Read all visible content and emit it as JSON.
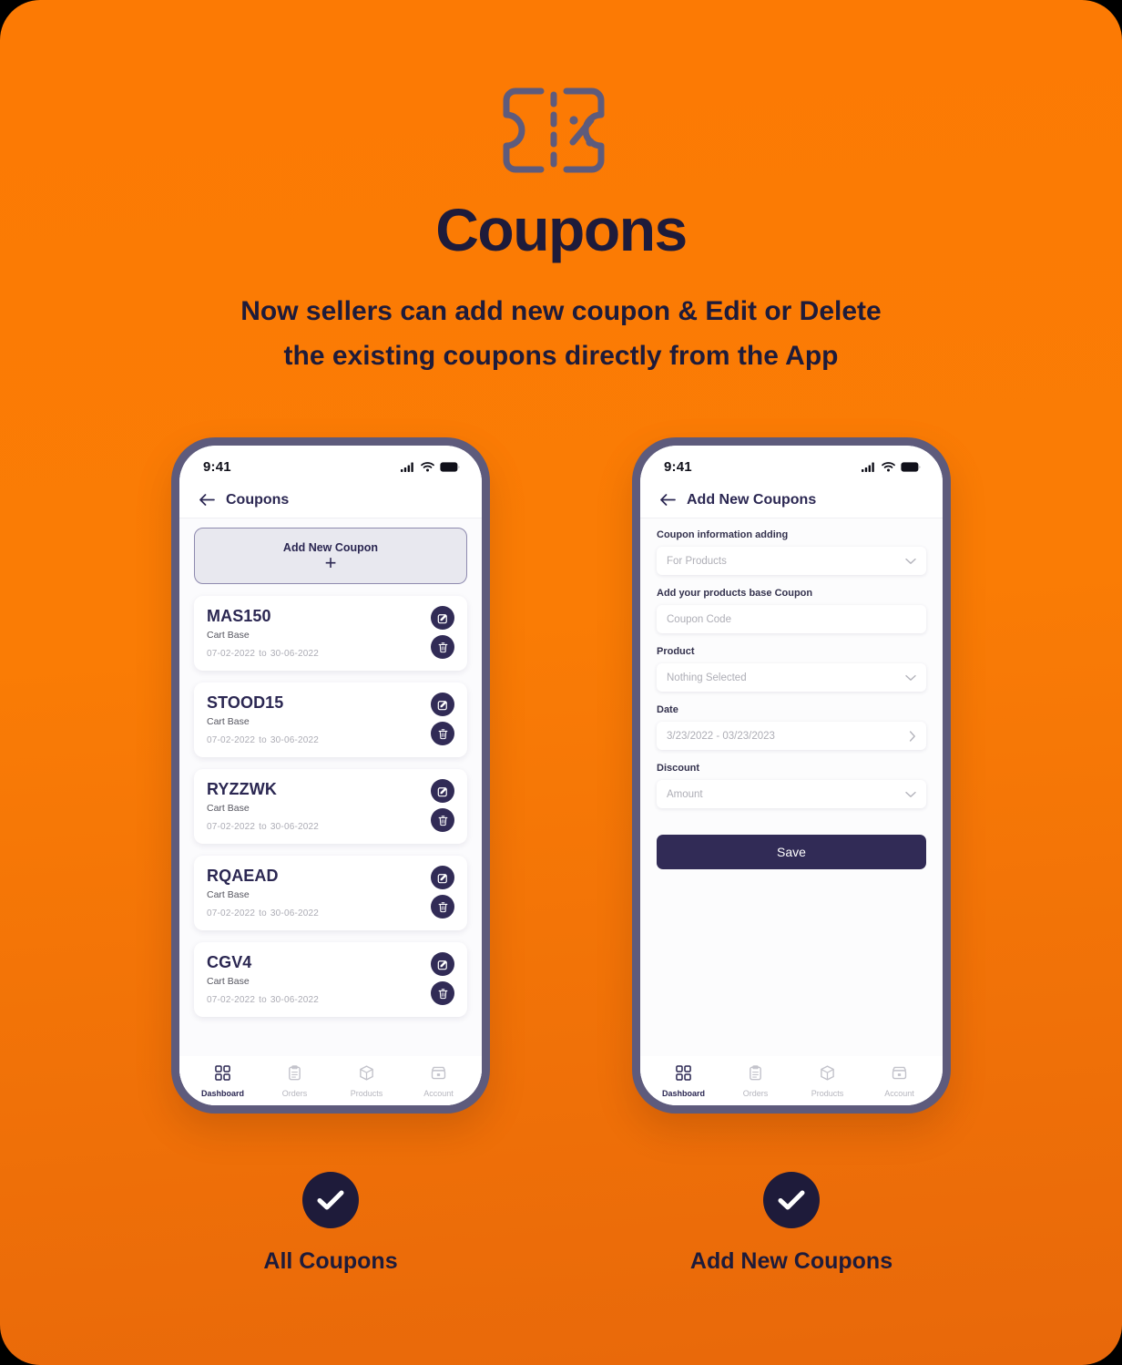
{
  "theme": {
    "background": "#FC7A04",
    "ink": "#1E1B3A",
    "accent": "#312B56",
    "frame": "#5E5B7C"
  },
  "hero": {
    "icon": "coupon-percent-icon",
    "title": "Coupons",
    "subtitle_line1": "Now sellers can add new coupon & Edit or Delete",
    "subtitle_line2": "the existing coupons directly from the App"
  },
  "status_bar": {
    "time": "9:41",
    "icons": [
      "cellular-signal-icon",
      "wifi-icon",
      "battery-icon"
    ]
  },
  "bottom_nav": {
    "items": [
      {
        "label": "Dashboard",
        "icon": "grid-icon",
        "active": true
      },
      {
        "label": "Orders",
        "icon": "clipboard-icon",
        "active": false
      },
      {
        "label": "Products",
        "icon": "box-icon",
        "active": false
      },
      {
        "label": "Account",
        "icon": "store-icon",
        "active": false
      }
    ]
  },
  "screen_list": {
    "app_bar": {
      "back_icon": "back-arrow-icon",
      "title": "Coupons"
    },
    "add_new": {
      "label": "Add New Coupon",
      "plus": "+"
    },
    "row_actions": {
      "edit_icon": "edit-pencil-icon",
      "delete_icon": "trash-icon"
    },
    "date_separator": "to",
    "coupons": [
      {
        "code": "MAS150",
        "type": "Cart Base",
        "start": "07-02-2022",
        "end": "30-06-2022"
      },
      {
        "code": "STOOD15",
        "type": "Cart Base",
        "start": "07-02-2022",
        "end": "30-06-2022"
      },
      {
        "code": "RYZZWK",
        "type": "Cart Base",
        "start": "07-02-2022",
        "end": "30-06-2022"
      },
      {
        "code": "RQAEAD",
        "type": "Cart Base",
        "start": "07-02-2022",
        "end": "30-06-2022"
      },
      {
        "code": "CGV4",
        "type": "Cart Base",
        "start": "07-02-2022",
        "end": "30-06-2022"
      }
    ],
    "ghost_coupon": {
      "code": "MAS150",
      "type": "Cart Base"
    }
  },
  "screen_form": {
    "app_bar": {
      "back_icon": "back-arrow-icon",
      "title": "Add New Coupons"
    },
    "fields": [
      {
        "label": "Coupon information adding",
        "value": "For Products",
        "control": "chevron-down-icon"
      },
      {
        "label": "Add your products base Coupon",
        "value": "Coupon Code",
        "control": "none"
      },
      {
        "label": "Product",
        "value": "Nothing Selected",
        "control": "chevron-down-icon"
      },
      {
        "label": "Date",
        "value": "3/23/2022 - 03/23/2023",
        "control": "chevron-right-icon"
      },
      {
        "label": "Discount",
        "value": "Amount",
        "control": "chevron-down-icon"
      }
    ],
    "save_label": "Save"
  },
  "captions": {
    "left": {
      "icon": "check-circle-icon",
      "label": "All Coupons"
    },
    "right": {
      "icon": "check-circle-icon",
      "label": "Add New Coupons"
    }
  }
}
